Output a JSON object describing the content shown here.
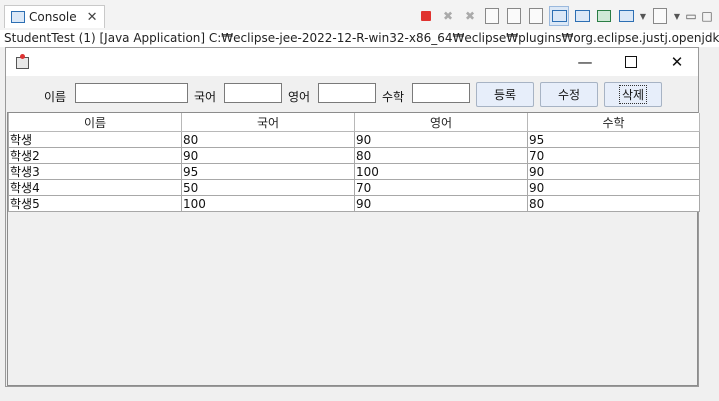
{
  "console": {
    "tab_label": "Console",
    "path": "StudentTest (1) [Java Application] C:₩eclipse-jee-2022-12-R-win32-x86_64₩eclipse₩plugins₩org.eclipse.justj.openjdk.hotspot.jre.full"
  },
  "toolbar_icons": [
    "terminate-icon",
    "remove-launch-icon",
    "remove-all-icon",
    "clear-console-icon",
    "scroll-lock-icon",
    "word-wrap-icon",
    "show-stdout-icon",
    "show-stderr-icon",
    "pin-console-icon",
    "display-console-icon",
    "open-console-icon",
    "minimize-icon",
    "maximize-icon"
  ],
  "window": {
    "minimize": "—",
    "close": "✕"
  },
  "form": {
    "name_label": "이름",
    "korean_label": "국어",
    "english_label": "영어",
    "math_label": "수학",
    "name_value": "",
    "korean_value": "",
    "english_value": "",
    "math_value": "",
    "register_label": "등록",
    "edit_label": "수정",
    "delete_label": "삭제"
  },
  "table": {
    "headers": [
      "이름",
      "국어",
      "영어",
      "수학"
    ],
    "rows": [
      [
        "학생",
        "80",
        "90",
        "95"
      ],
      [
        "학생2",
        "90",
        "80",
        "70"
      ],
      [
        "학생3",
        "95",
        "100",
        "90"
      ],
      [
        "학생4",
        "50",
        "70",
        "90"
      ],
      [
        "학생5",
        "100",
        "90",
        "80"
      ]
    ]
  }
}
